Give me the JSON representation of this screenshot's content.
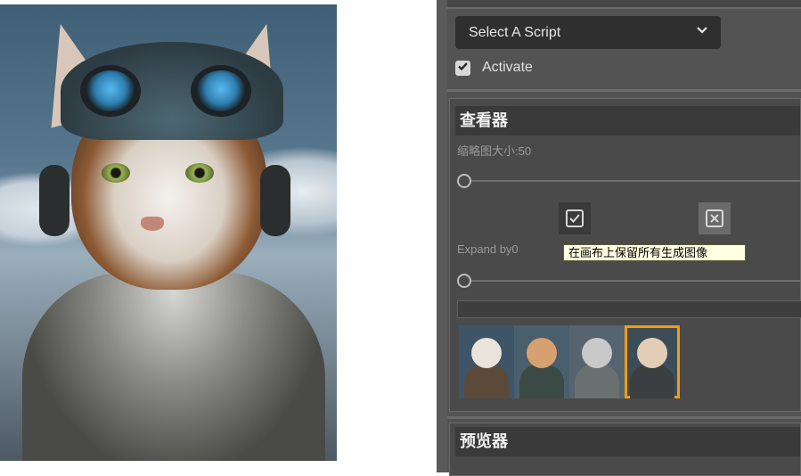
{
  "canvas": {
    "image_name": "cat-pilot-image"
  },
  "script_select": {
    "value": "Select A Script"
  },
  "activate": {
    "label": "Activate",
    "checked": true
  },
  "viewer": {
    "title": "查看器",
    "thumbnail_size_label": "缩略图大小:50",
    "expand_label": "Expand by0",
    "tooltip": "在画布上保留所有生成图像",
    "icons": [
      "checkbox-square-icon",
      "close-square-icon"
    ],
    "thumbnails": [
      {
        "name": "thumb-1",
        "bg": "#3d5566",
        "face": "#e9e3dc",
        "body": "#5b4a3a",
        "selected": false
      },
      {
        "name": "thumb-2",
        "bg": "#4a5f6d",
        "face": "#d7a070",
        "body": "#3b4a45",
        "selected": false
      },
      {
        "name": "thumb-3",
        "bg": "#55646e",
        "face": "#c9c9c9",
        "body": "#6a6f70",
        "selected": false
      },
      {
        "name": "thumb-4",
        "bg": "#3c4d58",
        "face": "#e3cdb6",
        "body": "#3b3f41",
        "selected": true
      }
    ]
  },
  "preview": {
    "title": "预览器"
  },
  "colors": {
    "accent": "#f39c12",
    "panel": "#535353",
    "tooltip_bg": "#ffffe1"
  }
}
